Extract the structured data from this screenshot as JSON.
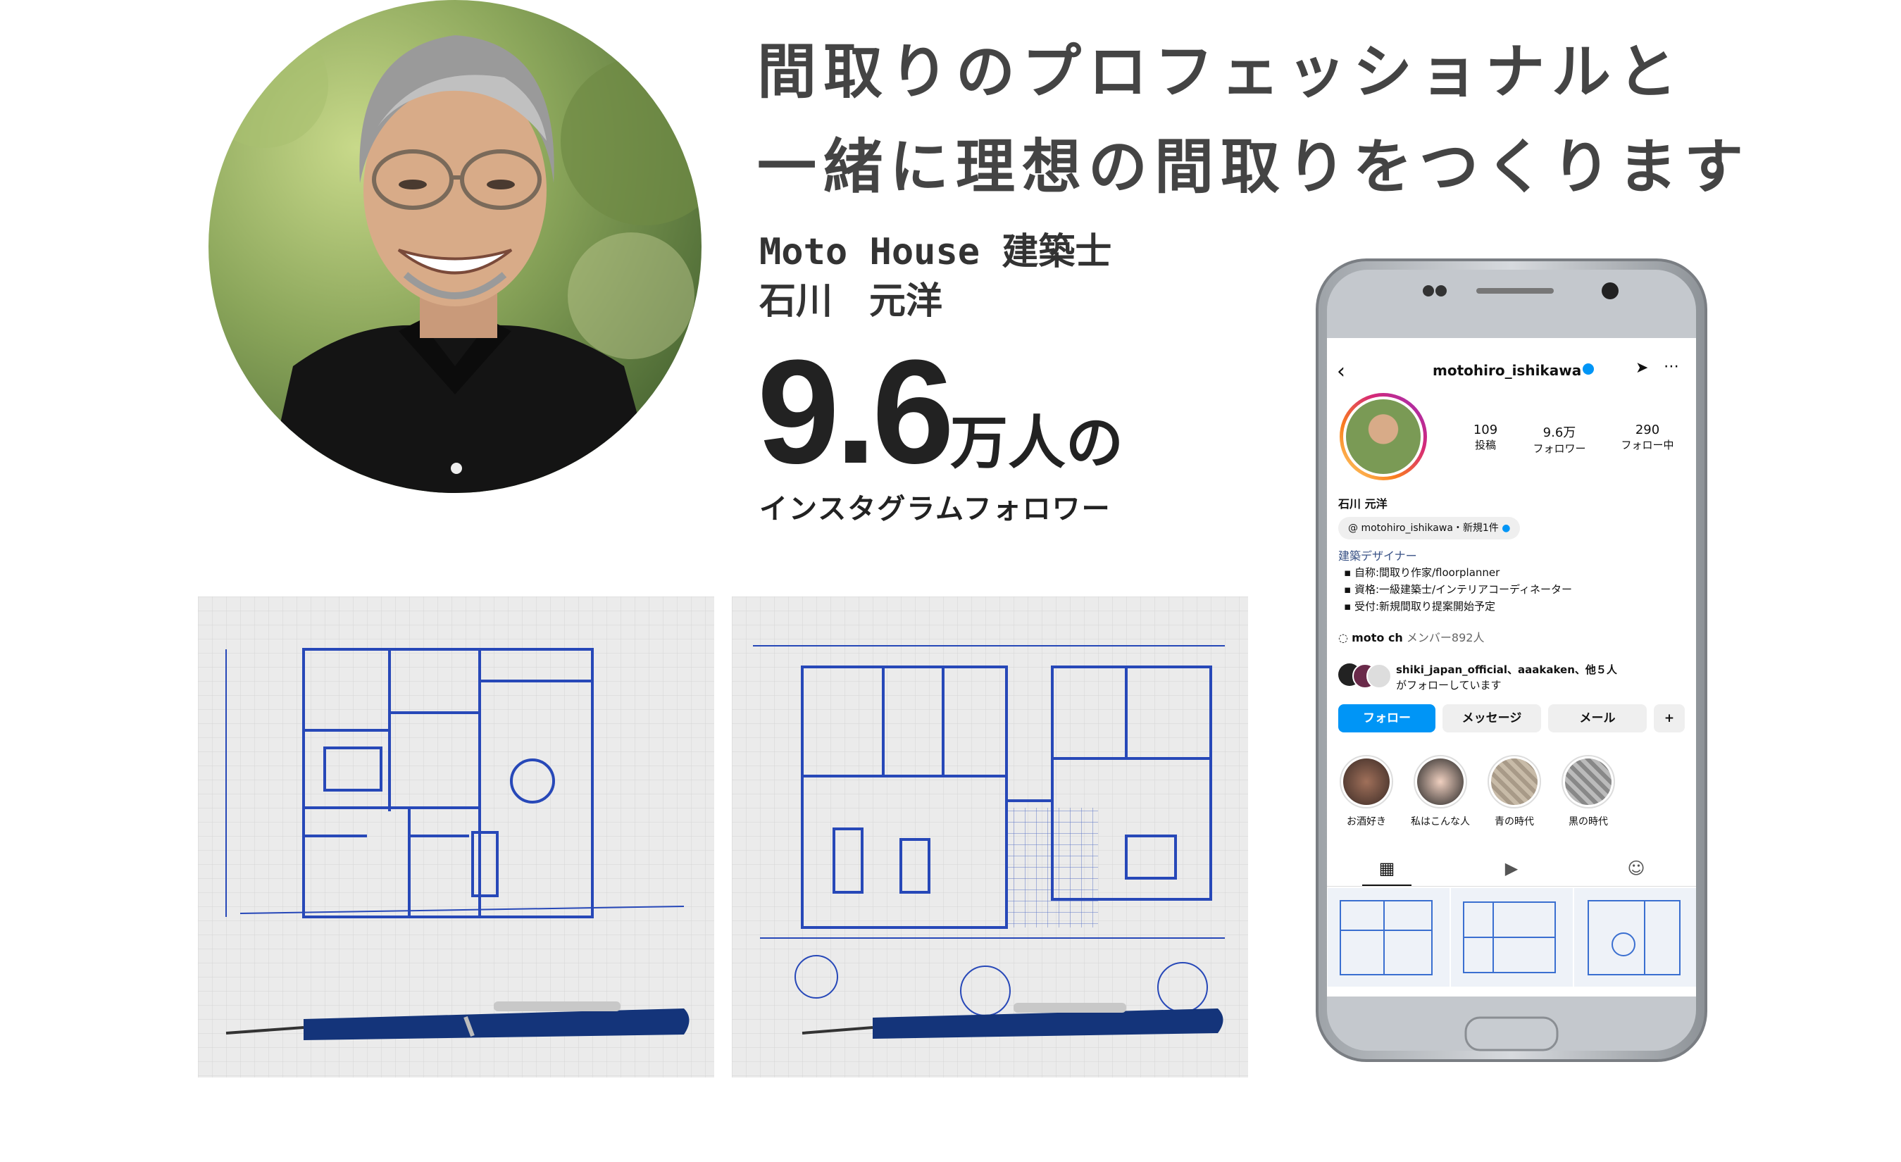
{
  "headline": {
    "line1": "間取りのプロフェッショナルと",
    "line2": "一緒に理想の間取りをつくります"
  },
  "profile": {
    "brand": "Moto House 建築士",
    "name": "石川　元洋"
  },
  "followers": {
    "number": "9.6",
    "unit": "万人",
    "particle": "の",
    "caption": "インスタグラムフォロワー"
  },
  "instagram": {
    "username": "motohiro_ishikawa",
    "stats": [
      {
        "value": "109",
        "label": "投稿"
      },
      {
        "value": "9.6万",
        "label": "フォロワー"
      },
      {
        "value": "290",
        "label": "フォロー中"
      }
    ],
    "display_name": "石川 元洋",
    "threads_badge": "motohiro_ishikawa・新規1件",
    "category": "建築デザイナー",
    "bio": [
      "自称:間取り作家/floorplanner",
      "資格:一級建築士/インテリアコーディネーター",
      "受付:新規間取り提案開始予定"
    ],
    "channel_name": "moto ch",
    "channel_members": "メンバー892人",
    "followed_by": "shiki_japan_official、aaakaken、他５人",
    "followed_by_2": "がフォローしています",
    "buttons": {
      "follow": "フォロー",
      "message": "メッセージ",
      "email": "メール"
    },
    "highlights": [
      "お酒好き",
      "私はこんな人",
      "青の時代",
      "黒の時代"
    ],
    "colors": {
      "accent": "#0095f6",
      "category": "#385185"
    }
  }
}
